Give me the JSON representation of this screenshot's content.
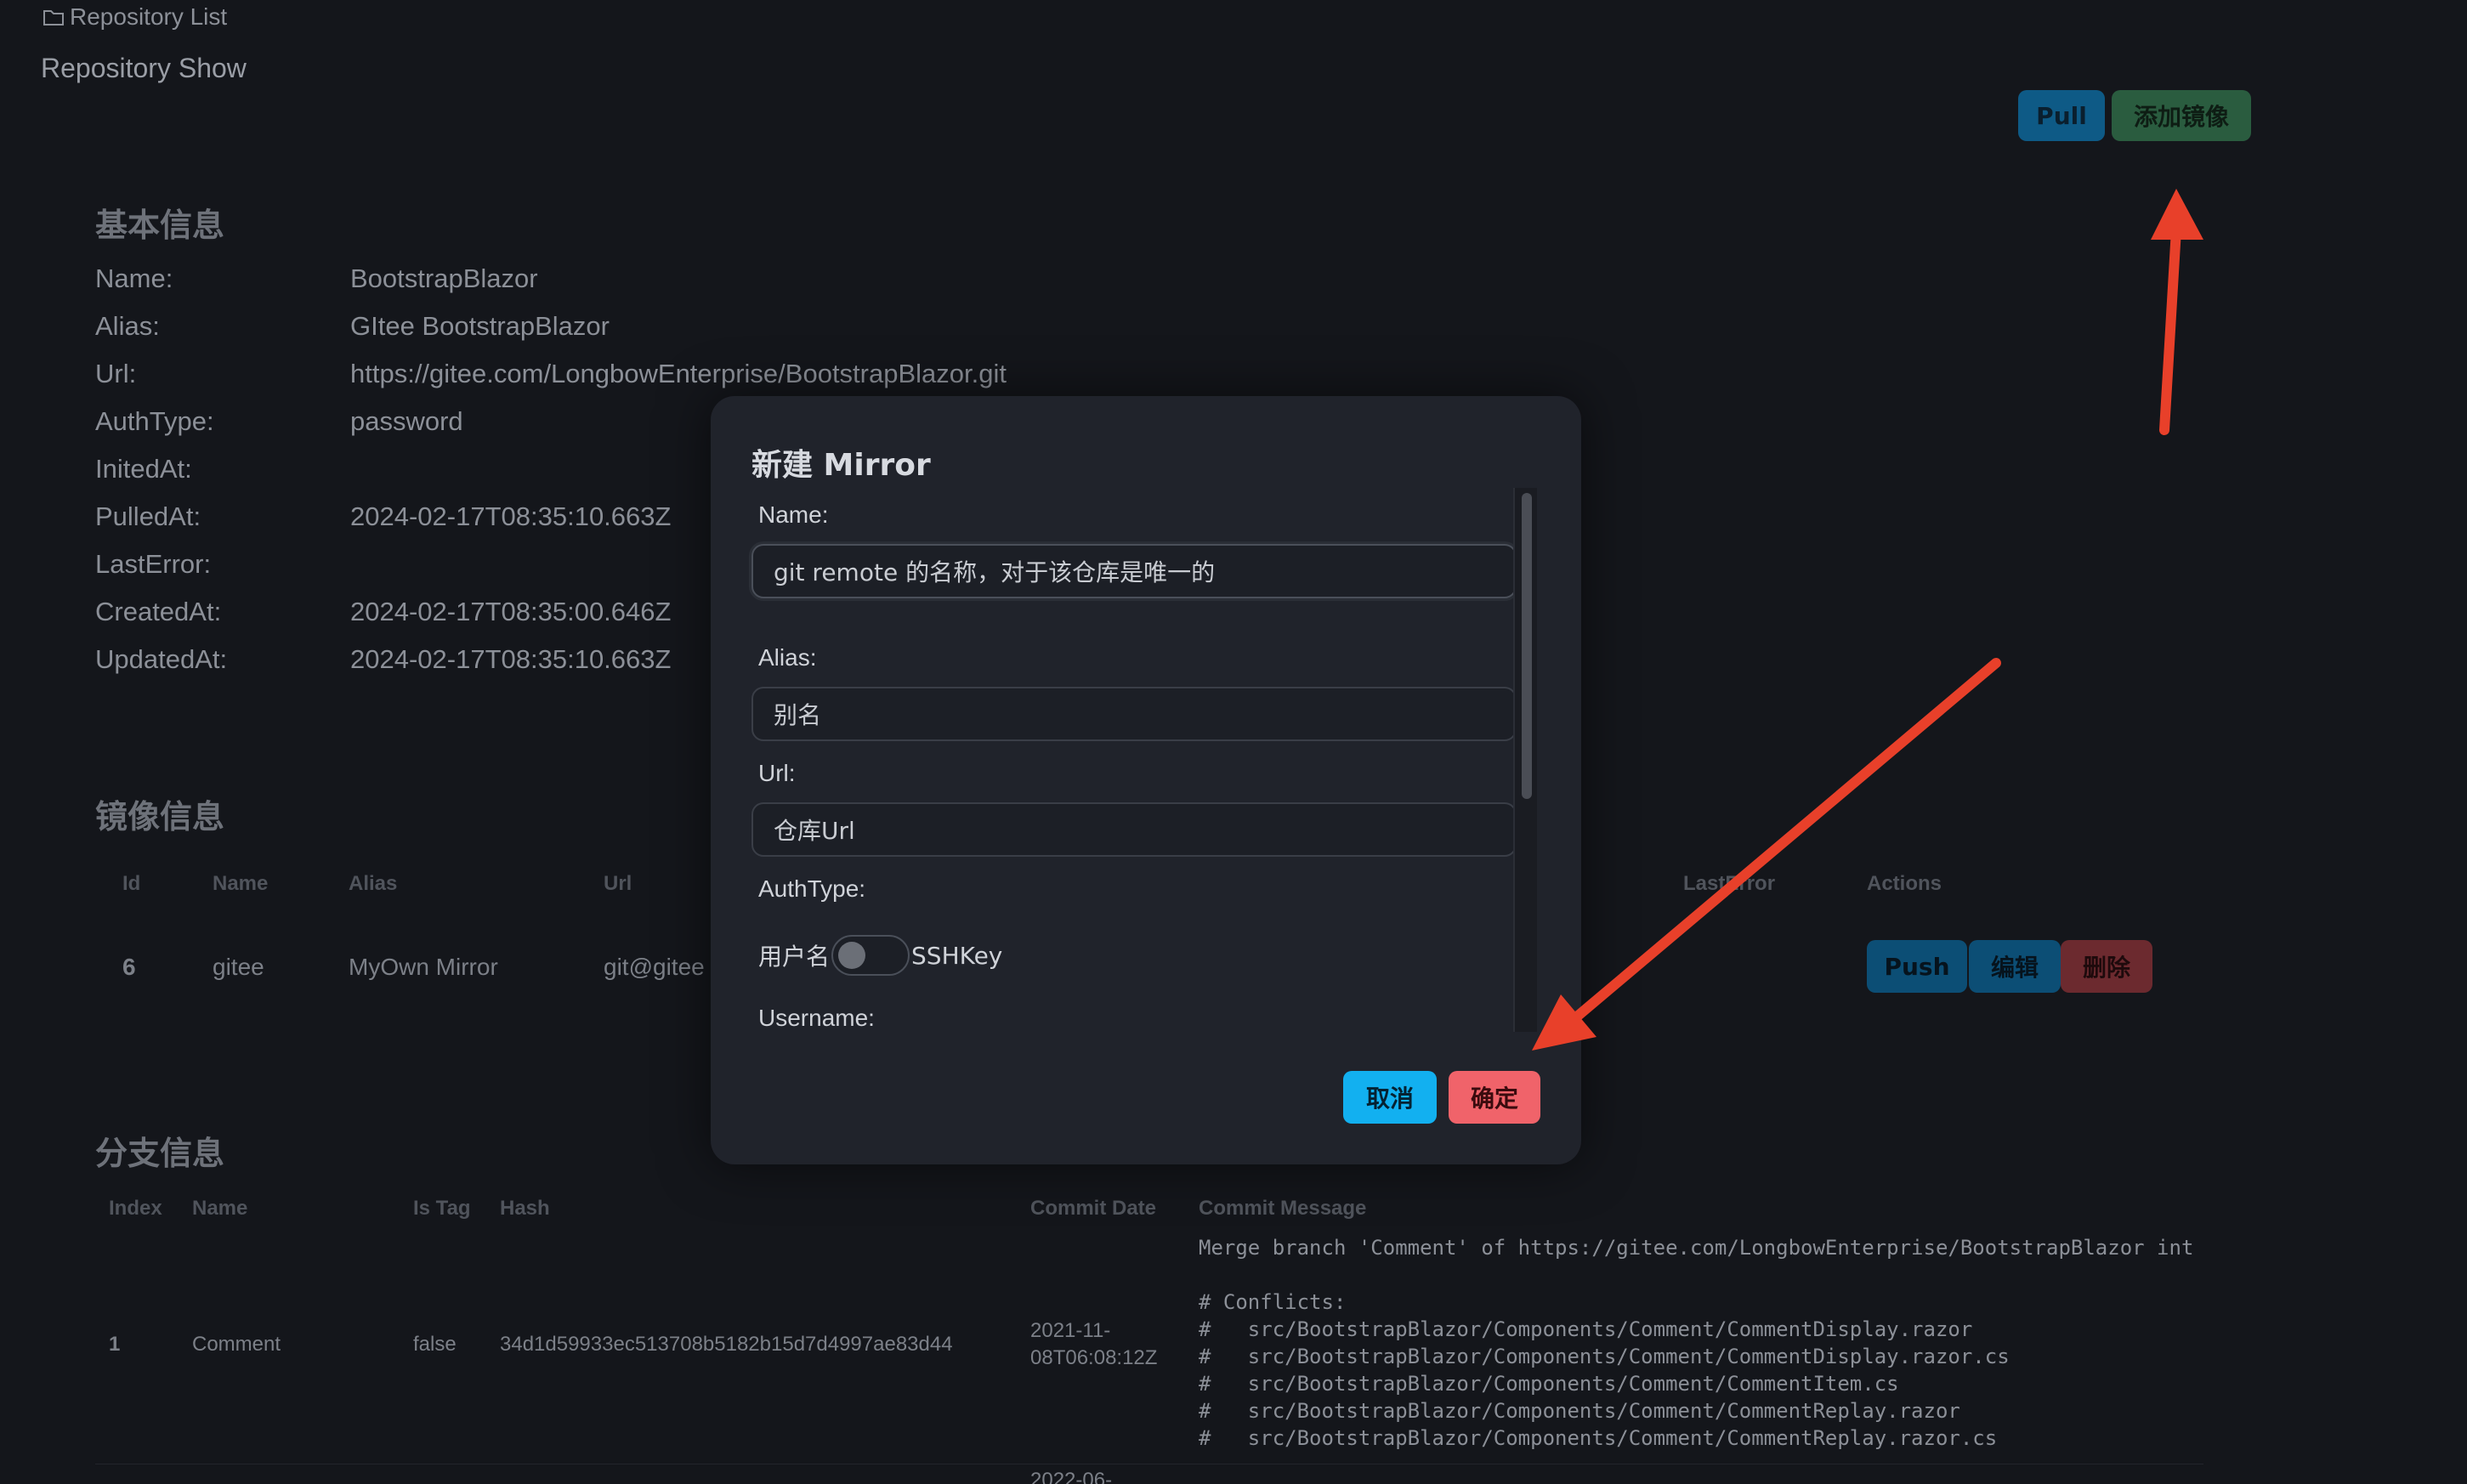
{
  "breadcrumb": {
    "label": "Repository List"
  },
  "page_title": "Repository Show",
  "toolbar": {
    "pull_label": "Pull",
    "add_mirror_label": "添加镜像"
  },
  "basic_info": {
    "heading": "基本信息",
    "rows": [
      {
        "key": "Name:",
        "value": "BootstrapBlazor"
      },
      {
        "key": "Alias:",
        "value": "GItee BootstrapBlazor"
      },
      {
        "key": "Url:",
        "value": "https://gitee.com/LongbowEnterprise/BootstrapBlazor.git"
      },
      {
        "key": "AuthType:",
        "value": "password"
      },
      {
        "key": "InitedAt:",
        "value": ""
      },
      {
        "key": "PulledAt:",
        "value": "2024-02-17T08:35:10.663Z"
      },
      {
        "key": "LastError:",
        "value": ""
      },
      {
        "key": "CreatedAt:",
        "value": "2024-02-17T08:35:00.646Z"
      },
      {
        "key": "UpdatedAt:",
        "value": "2024-02-17T08:35:10.663Z"
      }
    ]
  },
  "mirror_info": {
    "heading": "镜像信息",
    "columns": {
      "id": "Id",
      "name": "Name",
      "alias": "Alias",
      "url": "Url",
      "last_error": "LastError",
      "actions": "Actions"
    },
    "row": {
      "id": "6",
      "name": "gitee",
      "alias": "MyOwn Mirror",
      "url": "git@gitee"
    },
    "push_label": "Push",
    "edit_label": "编辑",
    "delete_label": "删除"
  },
  "branch_info": {
    "heading": "分支信息",
    "columns": {
      "index": "Index",
      "name": "Name",
      "is_tag": "Is Tag",
      "hash": "Hash",
      "commit_date": "Commit Date",
      "commit_message": "Commit Message"
    },
    "row": {
      "index": "1",
      "name": "Comment",
      "is_tag": "false",
      "hash": "34d1d59933ec513708b5182b15d7d4997ae83d44",
      "commit_date_1": "2021-11-",
      "commit_date_2": "08T06:08:12Z",
      "message_lines": [
        "Merge branch 'Comment' of https://gitee.com/LongbowEnterprise/BootstrapBlazor int",
        "",
        "# Conflicts:",
        "#   src/BootstrapBlazor/Components/Comment/CommentDisplay.razor",
        "#   src/BootstrapBlazor/Components/Comment/CommentDisplay.razor.cs",
        "#   src/BootstrapBlazor/Components/Comment/CommentItem.cs",
        "#   src/BootstrapBlazor/Components/Comment/CommentReplay.razor",
        "#   src/BootstrapBlazor/Components/Comment/CommentReplay.razor.cs"
      ]
    },
    "next_row_date_partial": "2022-06-"
  },
  "modal": {
    "title": "新建 Mirror",
    "name_label": "Name:",
    "name_placeholder": "git remote 的名称，对于该仓库是唯一的",
    "alias_label": "Alias:",
    "alias_placeholder": "别名",
    "url_label": "Url:",
    "url_placeholder": "仓库Url",
    "authtype_label": "AuthType:",
    "auth_off_label": "用户名",
    "auth_on_label": "SSHKey",
    "auth_sshkey_enabled": false,
    "username_label": "Username:",
    "cancel_label": "取消",
    "ok_label": "确定"
  },
  "annotation_color": "#e8402a"
}
